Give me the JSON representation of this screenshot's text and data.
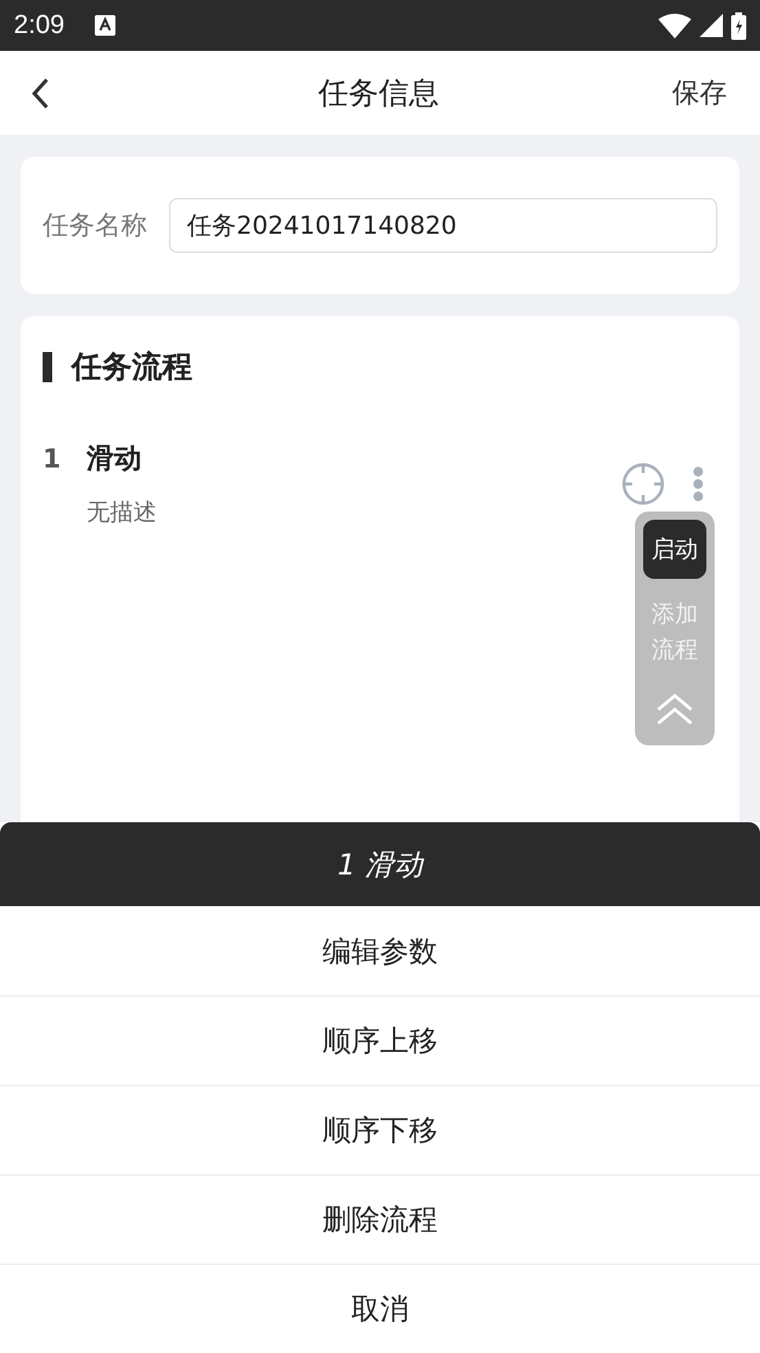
{
  "status_bar": {
    "time": "2:09"
  },
  "header": {
    "title": "任务信息",
    "action": "保存"
  },
  "task_name": {
    "label": "任务名称",
    "value": "任务20241017140820"
  },
  "flow": {
    "title": "任务流程",
    "steps": [
      {
        "index": "1",
        "name": "滑动",
        "description": "无描述"
      }
    ]
  },
  "float_panel": {
    "start": "启动",
    "add": "添加流程"
  },
  "sheet": {
    "title": "1 滑动",
    "options": [
      "编辑参数",
      "顺序上移",
      "顺序下移",
      "删除流程",
      "取消"
    ]
  }
}
